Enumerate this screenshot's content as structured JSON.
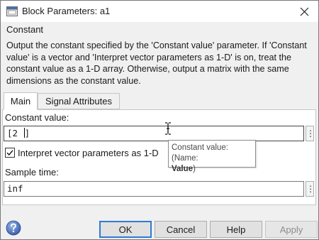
{
  "window": {
    "title": "Block Parameters: a1"
  },
  "block": {
    "type": "Constant",
    "description": "Output the constant specified by the 'Constant value' parameter. If 'Constant value' is a vector and 'Interpret vector parameters as 1-D' is on, treat the constant value as a 1-D array. Otherwise, output a matrix with the same dimensions as the constant value."
  },
  "tabs": [
    {
      "label": "Main",
      "active": true
    },
    {
      "label": "Signal Attributes",
      "active": false
    }
  ],
  "main": {
    "constant_value_label": "Constant value:",
    "constant_value": "[2 ]",
    "interpret_checkbox_label": "Interpret vector parameters as 1-D",
    "interpret_checked": true,
    "sample_time_label": "Sample time:",
    "sample_time": "inf",
    "menu_glyph": "⋮"
  },
  "tooltip": {
    "line1": "Constant value: (Name:",
    "line2": "Value",
    "line2_suffix": ")"
  },
  "footer": {
    "ok": "OK",
    "cancel": "Cancel",
    "help": "Help",
    "apply": "Apply",
    "apply_enabled": false
  },
  "icons": {
    "app": "simulink-block-icon",
    "close": "close-icon",
    "help": "help-question-icon",
    "checkbox": "checkmark-icon",
    "cursor": "text-ibeam-cursor-icon"
  },
  "colors": {
    "accent": "#2f7bd4",
    "dialog_bg": "#f0f0f0"
  }
}
